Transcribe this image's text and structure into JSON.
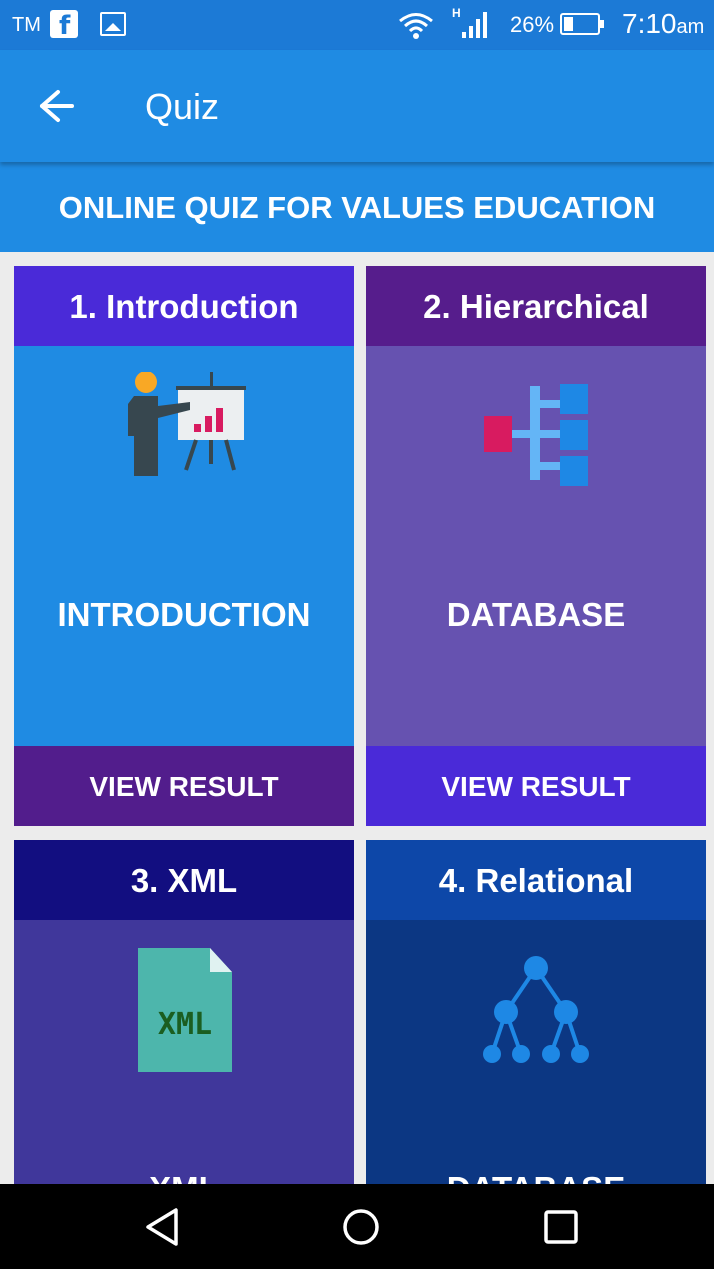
{
  "status_bar": {
    "carrier": "TM",
    "facebook_letter": "f",
    "battery_percent": "26%",
    "time": "7:10",
    "time_suffix": "am",
    "network_type": "H",
    "icons": [
      "facebook-icon",
      "image-icon",
      "wifi-icon",
      "signal-icon",
      "battery-icon"
    ]
  },
  "app_bar": {
    "title": "Quiz",
    "back_icon": "arrow-left-icon"
  },
  "subheader": "ONLINE QUIZ FOR VALUES EDUCATION",
  "cards": [
    {
      "heading": "1. Introduction",
      "name": "INTRODUCTION",
      "action": "VIEW RESULT",
      "icon": "presentation-chart-icon",
      "head_color": "#4a2ad8",
      "body_color": "#1f8be3",
      "foot_color": "#521d8c"
    },
    {
      "heading": "2. Hierarchical",
      "name": "DATABASE",
      "action": "VIEW RESULT",
      "icon": "hierarchy-icon",
      "head_color": "#561d8c",
      "body_color": "#6652b0",
      "foot_color": "#4a2ad8"
    },
    {
      "heading": "3. XML",
      "name": "XML",
      "icon": "xml-file-icon",
      "icon_text": "XML",
      "head_color": "#120e80",
      "body_color": "#40379b"
    },
    {
      "heading": "4. Relational",
      "name": "DATABASE",
      "icon": "tree-network-icon",
      "head_color": "#0d47a8",
      "body_color": "#0c3783"
    }
  ],
  "nav_bar": {
    "icons": [
      "back-triangle-icon",
      "home-circle-icon",
      "recents-square-icon"
    ]
  }
}
